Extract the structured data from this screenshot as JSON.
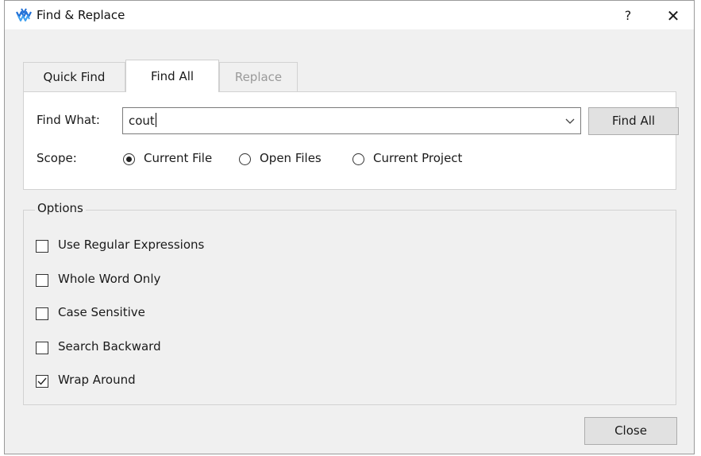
{
  "dialog": {
    "title": "Find & Replace",
    "help_label": "?",
    "close_glyph": "✕",
    "icon": "gowin-logo-icon"
  },
  "tabs": [
    {
      "label": "Quick Find",
      "state": "normal"
    },
    {
      "label": "Find All",
      "state": "active"
    },
    {
      "label": "Replace",
      "state": "disabled"
    }
  ],
  "find": {
    "label": "Find What:",
    "value": "cout",
    "button_label": "Find All"
  },
  "scope": {
    "label": "Scope:",
    "options": [
      {
        "label": "Current File",
        "selected": true
      },
      {
        "label": "Open Files",
        "selected": false
      },
      {
        "label": "Current Project",
        "selected": false
      }
    ]
  },
  "options": {
    "title": "Options",
    "items": [
      {
        "label": "Use Regular Expressions",
        "checked": false
      },
      {
        "label": "Whole Word Only",
        "checked": false
      },
      {
        "label": "Case Sensitive",
        "checked": false
      },
      {
        "label": "Search Backward",
        "checked": false
      },
      {
        "label": "Wrap Around",
        "checked": true
      }
    ]
  },
  "footer": {
    "close_label": "Close"
  },
  "colors": {
    "accent": "#1f6fd6",
    "window_bg": "#f0f0f0",
    "button_bg": "#e1e1e1"
  }
}
